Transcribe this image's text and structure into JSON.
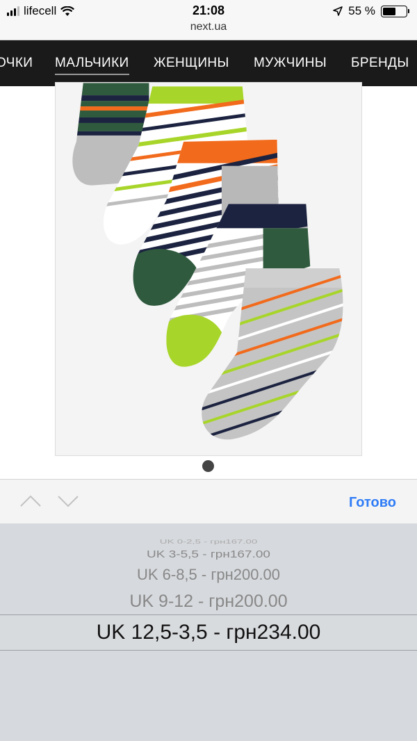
{
  "status_bar": {
    "carrier": "lifecell",
    "time": "21:08",
    "url": "next.ua",
    "battery": "55 %",
    "battery_level": 0.55
  },
  "nav": {
    "items": [
      {
        "label": "ОЧКИ"
      },
      {
        "label": "МАЛЬЧИКИ",
        "active": true
      },
      {
        "label": "ЖЕНЩИНЫ"
      },
      {
        "label": "МУЖЧИНЫ"
      },
      {
        "label": "БРЕНДЫ"
      }
    ]
  },
  "product": {
    "image": "striped-socks-5-pack",
    "colors": {
      "green": "#2f5a3e",
      "lime": "#a8d52a",
      "orange": "#f26a1b",
      "navy": "#1c2340",
      "grey": "#b8b8b8",
      "white": "#ffffff"
    }
  },
  "carousel": {
    "pages": 1,
    "current": 1
  },
  "toolbar": {
    "prev_icon": "chevron-up-icon",
    "next_icon": "chevron-down-icon",
    "done_label": "Готово"
  },
  "picker": {
    "options": [
      "UK 0-2,5 - грн167.00",
      "UK 3-5,5 - грн167.00",
      "UK 6-8,5 - грн200.00",
      "UK 9-12 - грн200.00",
      "UK 12,5-3,5 - грн234.00"
    ],
    "selected": "UK 12,5-3,5 - грн234.00"
  }
}
